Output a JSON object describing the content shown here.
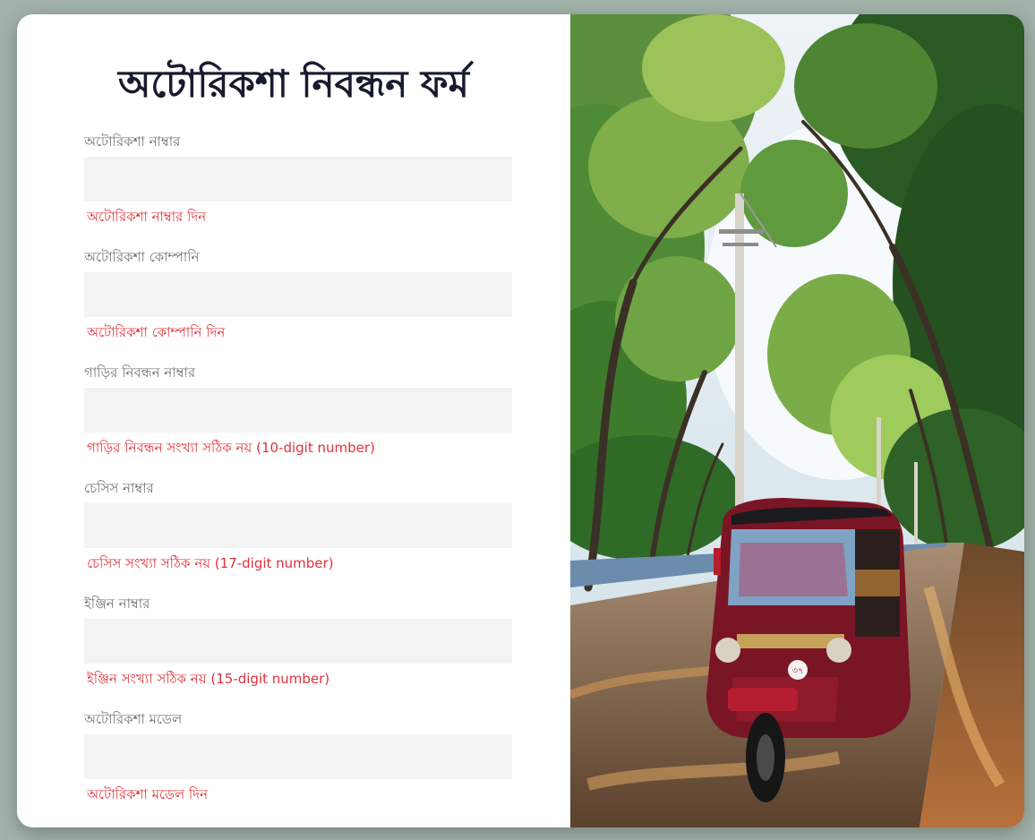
{
  "form": {
    "title": "অটোরিকশা নিবন্ধন ফর্ম",
    "fields": [
      {
        "label": "অটোরিকশা নাম্বার",
        "value": "",
        "error": "অটোরিকশা নাম্বার দিন"
      },
      {
        "label": "অটোরিকশা কোম্পানি",
        "value": "",
        "error": "অটোরিকশা কোম্পানি দিন"
      },
      {
        "label": "গাড়ির নিবন্ধন নাম্বার",
        "value": "",
        "error": "গাড়ির নিবন্ধন সংখ্যা সঠিক নয় (10-digit number)"
      },
      {
        "label": "চেসিস নাম্বার",
        "value": "",
        "error": "চেসিস সংখ্যা সঠিক নয় (17-digit number)"
      },
      {
        "label": "ইঞ্জিন নাম্বার",
        "value": "",
        "error": "ইঞ্জিন সংখ্যা সঠিক নয় (15-digit number)"
      },
      {
        "label": "অটোরিকশা মডেল",
        "value": "",
        "error": "অটোরিকশা মডেল দিন"
      }
    ]
  },
  "photo": {
    "plate_number": "৩৭"
  },
  "colors": {
    "page_background": "#a3b3aa",
    "title_text": "#161c2d",
    "label_text": "#707070",
    "input_background": "#f3f3f3",
    "error_text": "#e0313b"
  }
}
